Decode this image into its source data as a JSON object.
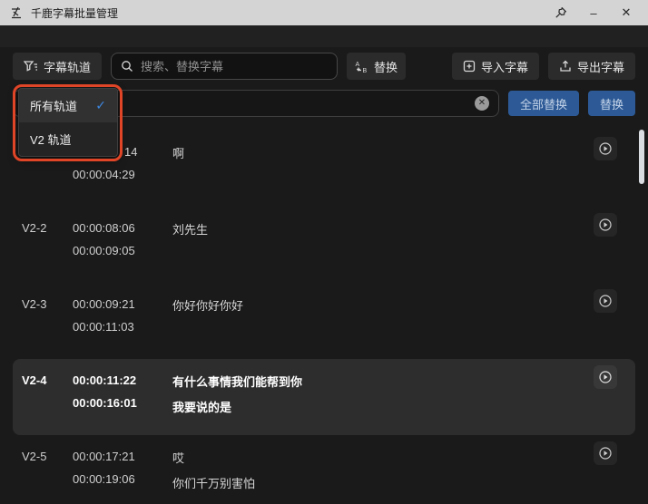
{
  "window": {
    "title": "千鹿字幕批量管理",
    "minimize_glyph": "–",
    "close_glyph": "✕"
  },
  "toolbar": {
    "track_filter_label": "字幕轨道",
    "search_placeholder": "搜索、替换字幕",
    "replace_toggle_label": "替换",
    "import_label": "导入字幕",
    "export_label": "导出字幕"
  },
  "replace_bar": {
    "input_value": "",
    "clear_glyph": "✕",
    "replace_all_label": "全部替换",
    "replace_label": "替换"
  },
  "track_dropdown": {
    "items": [
      {
        "label": "所有轨道",
        "selected": true,
        "check_glyph": "✓"
      },
      {
        "label": "V2 轨道",
        "selected": false
      }
    ]
  },
  "subtitles": {
    "rows": [
      {
        "id": "",
        "start": "14",
        "end": "00:00:04:29",
        "line1": "啊",
        "line2": ""
      },
      {
        "id": "V2-2",
        "start": "00:00:08:06",
        "end": "00:00:09:05",
        "line1": "刘先生",
        "line2": ""
      },
      {
        "id": "V2-3",
        "start": "00:00:09:21",
        "end": "00:00:11:03",
        "line1": "你好你好你好",
        "line2": ""
      },
      {
        "id": "V2-4",
        "start": "00:00:11:22",
        "end": "00:00:16:01",
        "line1": "有什么事情我们能帮到你",
        "line2": "我要说的是"
      },
      {
        "id": "V2-5",
        "start": "00:00:17:21",
        "end": "00:00:19:06",
        "line1": "哎",
        "line2": "你们千万别害怕"
      }
    ]
  },
  "colors": {
    "accent_blue": "#3d87e0",
    "button_blue": "#2d5a96",
    "annotation_red": "#e04527",
    "titlebar_bg": "#d4d4d4",
    "app_bg": "#1a1a1a"
  }
}
